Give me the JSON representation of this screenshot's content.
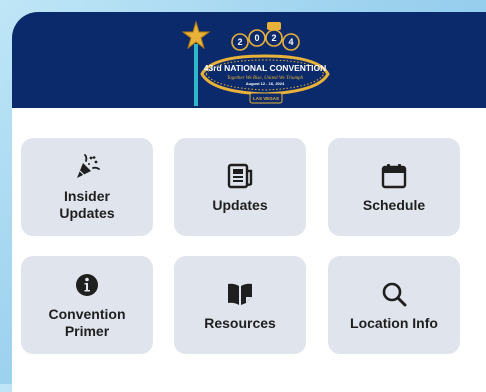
{
  "header": {
    "logo": {
      "year_digits": [
        "2",
        "0",
        "2",
        "4"
      ],
      "title": "43rd NATIONAL CONVENTION",
      "tagline": "Together We Rise, United We Triumph",
      "dates": "August 12 - 16, 2024",
      "city": "LAS VEGAS",
      "colors": {
        "gold": "#e8b23a",
        "navy": "#0b2a6b",
        "teal": "#2fb7c9"
      }
    }
  },
  "menu": {
    "tiles": [
      {
        "label": "Insider\nUpdates",
        "icon": "party-popper-icon"
      },
      {
        "label": "Updates",
        "icon": "newspaper-icon"
      },
      {
        "label": "Schedule",
        "icon": "calendar-icon"
      },
      {
        "label": "Convention\nPrimer",
        "icon": "info-icon"
      },
      {
        "label": "Resources",
        "icon": "book-icon"
      },
      {
        "label": "Location Info",
        "icon": "search-icon"
      }
    ]
  },
  "theme": {
    "tile_bg": "#e0e4ec",
    "header_bg": "#0b2a6b",
    "bg_gradient": "#9fd3ef"
  }
}
